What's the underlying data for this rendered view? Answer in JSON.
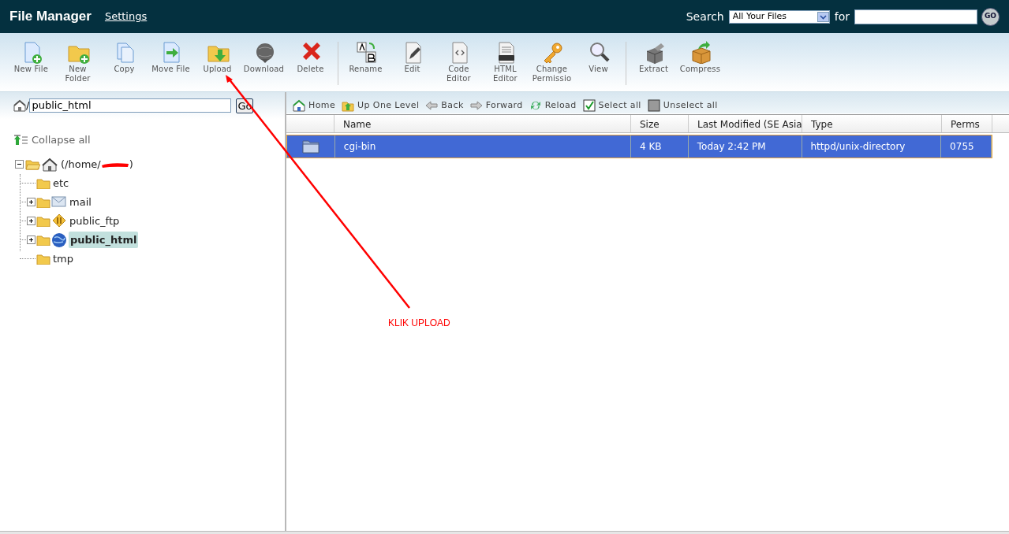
{
  "header": {
    "title": "File Manager",
    "settings_link": "Settings",
    "search_label": "Search",
    "search_scope": "All Your Files",
    "for_label": "for",
    "go_button": "GO"
  },
  "toolbar": [
    {
      "kind": "button",
      "label": "New File"
    },
    {
      "kind": "button",
      "label": "New Folder"
    },
    {
      "kind": "button",
      "label": "Copy"
    },
    {
      "kind": "button",
      "label": "Move File"
    },
    {
      "kind": "button",
      "label": "Upload"
    },
    {
      "kind": "button",
      "label": "Download"
    },
    {
      "kind": "button",
      "label": "Delete"
    },
    {
      "kind": "separator"
    },
    {
      "kind": "button",
      "label": "Rename"
    },
    {
      "kind": "button",
      "label": "Edit"
    },
    {
      "kind": "button",
      "label": "Code Editor"
    },
    {
      "kind": "button",
      "label": "HTML Editor"
    },
    {
      "kind": "button",
      "label": "Change Permissio"
    },
    {
      "kind": "button",
      "label": "View"
    },
    {
      "kind": "separator"
    },
    {
      "kind": "button",
      "label": "Extract"
    },
    {
      "kind": "button",
      "label": "Compress"
    }
  ],
  "path_bar": {
    "slash": "/",
    "value": "public_html",
    "go_button": "Go"
  },
  "collapse_all": "Collapse all",
  "tree": {
    "label_start": "(/home/",
    "label_end": ")",
    "redacted": true,
    "expanded": true,
    "children": [
      {
        "label": "etc",
        "expandable": false,
        "selected": false
      },
      {
        "label": "mail",
        "expandable": true,
        "selected": false
      },
      {
        "label": "public_ftp",
        "expandable": true,
        "selected": false
      },
      {
        "label": "public_html",
        "expandable": true,
        "selected": true
      },
      {
        "label": "tmp",
        "expandable": false,
        "selected": false
      }
    ]
  },
  "nav": [
    {
      "label": "Home"
    },
    {
      "label": "Up One Level"
    },
    {
      "label": "Back"
    },
    {
      "label": "Forward"
    },
    {
      "label": "Reload"
    },
    {
      "label": "Select all"
    },
    {
      "label": "Unselect all"
    }
  ],
  "table": {
    "columns": [
      "Name",
      "Size",
      "Last Modified (SE Asia",
      "Type",
      "Perms"
    ],
    "rows": [
      {
        "cells": [
          "cgi-bin",
          "4 KB",
          "Today 2:42 PM",
          "httpd/unix-directory",
          "0755"
        ],
        "selected": true
      }
    ]
  },
  "annotation": {
    "text": "KLIK UPLOAD"
  }
}
